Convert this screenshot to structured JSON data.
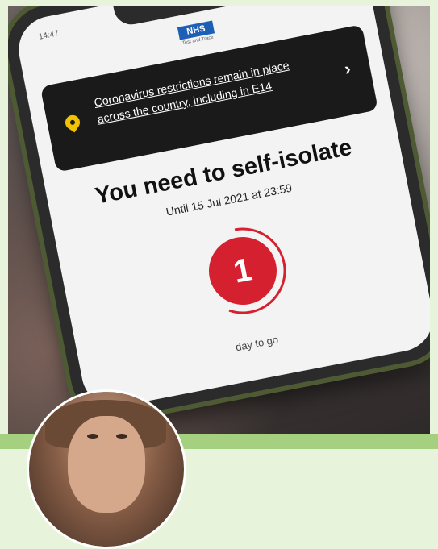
{
  "phone": {
    "status_time": "14:47",
    "nhs_logo": "NHS",
    "nhs_subtitle": "Test and Trace",
    "banner_text": "Coronavirus restrictions remain in place across the country, including in E14",
    "banner_chevron": "›",
    "headline": "You need to self-isolate",
    "until_text": "Until 15 Jul 2021 at 23:59",
    "counter_value": "1",
    "counter_label": "day to go",
    "colors": {
      "banner_bg": "#1a1a1a",
      "pin": "#f2c200",
      "counter": "#d5202f",
      "nhs_blue": "#1d5fb6"
    }
  },
  "background": {
    "frame_color": "#e8f3dc",
    "band_color": "#a5d07f"
  }
}
